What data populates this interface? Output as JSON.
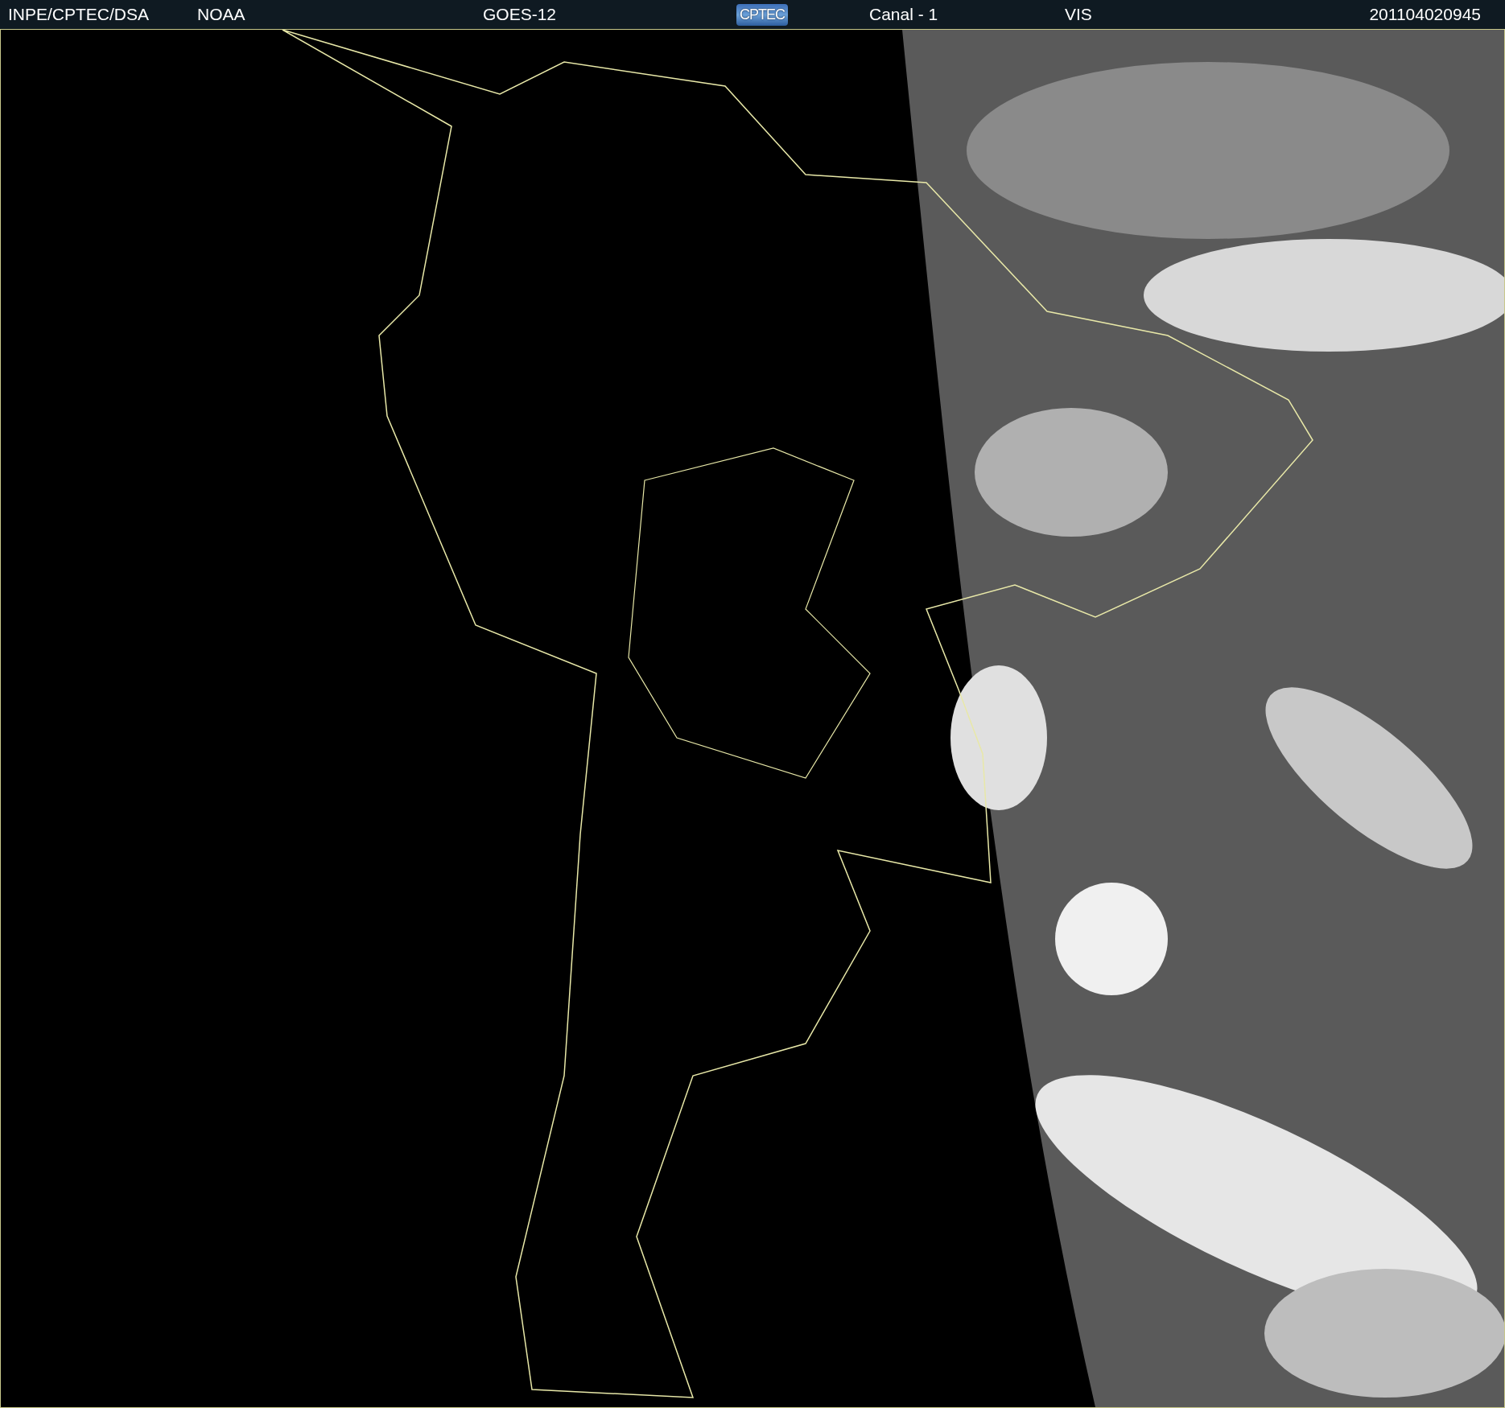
{
  "header": {
    "items": [
      {
        "kind": "text",
        "text": "INPE/CPTEC/DSA"
      },
      {
        "kind": "text",
        "text": "NOAA"
      },
      {
        "kind": "text",
        "text": "GOES-12"
      },
      {
        "kind": "logo",
        "text": "CPTEC"
      },
      {
        "kind": "text",
        "text": "Canal - 1"
      },
      {
        "kind": "text",
        "text": "VIS"
      },
      {
        "kind": "text",
        "text": "201104020945"
      }
    ]
  }
}
